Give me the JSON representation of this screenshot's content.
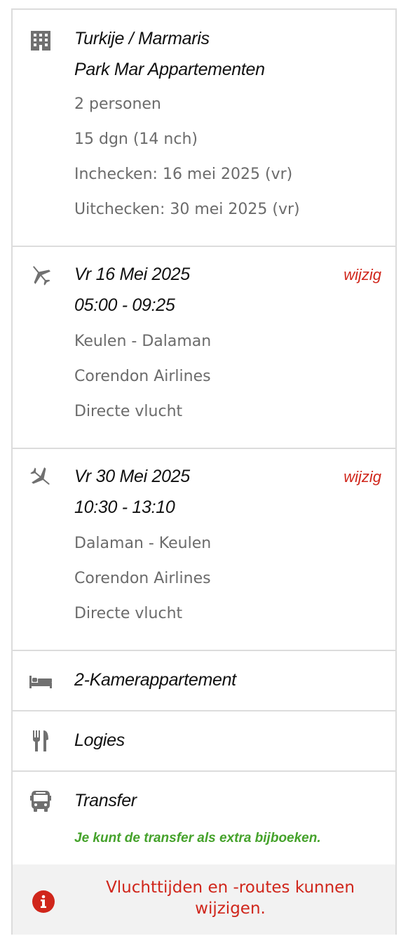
{
  "accommodation": {
    "icon": "building-icon",
    "destination": "Turkije / Marmaris",
    "name": "Park Mar Appartementen",
    "persons": "2 personen",
    "duration": "15 dgn (14 nch)",
    "checkin": "Inchecken: 16 mei 2025 (vr)",
    "checkout": "Uitchecken: 30 mei 2025 (vr)"
  },
  "flights": [
    {
      "icon": "airplane-departure-icon",
      "date": "Vr 16 Mei 2025",
      "times": "05:00 - 09:25",
      "route": "Keulen - Dalaman",
      "airline": "Corendon Airlines",
      "type": "Directe vlucht",
      "change_label": "wijzig"
    },
    {
      "icon": "airplane-arrival-icon",
      "date": "Vr 30 Mei 2025",
      "times": "10:30 - 13:10",
      "route": "Dalaman - Keulen",
      "airline": "Corendon Airlines",
      "type": "Directe vlucht",
      "change_label": "wijzig"
    }
  ],
  "room": {
    "icon": "bed-icon",
    "label": "2-Kamerappartement"
  },
  "board": {
    "icon": "fork-knife-icon",
    "label": "Logies"
  },
  "transfer": {
    "icon": "bus-icon",
    "label": "Transfer",
    "note": "Je kunt de transfer als extra bijboeken."
  },
  "notice": {
    "icon": "info-icon",
    "text": "Vluchttijden en -routes kunnen wijzigen."
  },
  "colors": {
    "accent_red": "#d0261b",
    "green": "#45a22b",
    "icon_gray": "#707070"
  }
}
